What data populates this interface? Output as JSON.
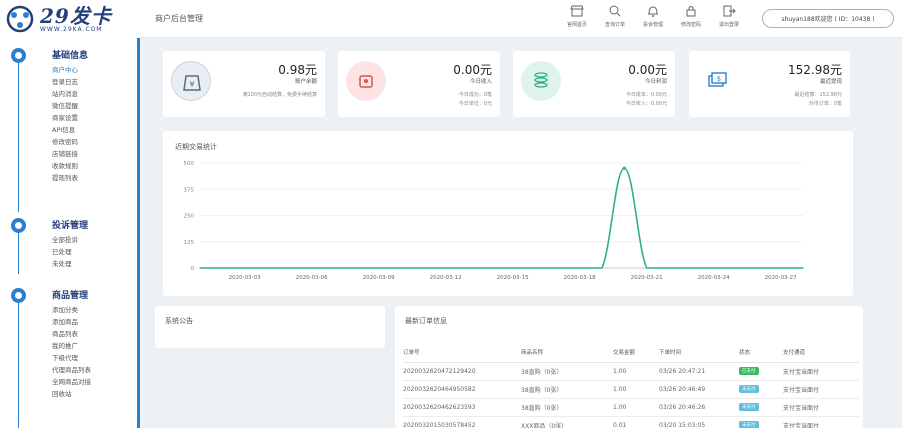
{
  "logo": {
    "main": "29发卡",
    "sub": "WWW.29KA.COM"
  },
  "header": {
    "title": "商户后台管理",
    "nav": [
      {
        "label": "官网首页",
        "icon": "store-icon"
      },
      {
        "label": "查询订单",
        "icon": "search-icon"
      },
      {
        "label": "投诉管理",
        "icon": "bell-icon"
      },
      {
        "label": "修改密码",
        "icon": "lock-icon"
      },
      {
        "label": "退出登录",
        "icon": "logout-icon"
      }
    ],
    "user": "shuyan188欢迎您 ( ID：10438 )"
  },
  "sidebar": {
    "groups": [
      {
        "title": "基础信息",
        "items": [
          "商户中心",
          "登录日志",
          "站内消息",
          "微信提醒",
          "商家设置",
          "API信息",
          "修改密码",
          "店铺链接",
          "收款规则",
          "提现列表"
        ]
      },
      {
        "title": "投诉管理",
        "items": [
          "全部投诉",
          "已处理",
          "未处理"
        ]
      },
      {
        "title": "商品管理",
        "items": [
          "添加分类",
          "添加商品",
          "商品列表",
          "我的推广",
          "下级代理",
          "代理商品列表",
          "全网商品对接",
          "回收站"
        ]
      }
    ]
  },
  "stats": [
    {
      "value": "0.98元",
      "label": "账户余额",
      "subs": [
        "满100元自动结算，免费手续结算"
      ],
      "color": "#e9eef4",
      "icon": "money-bag-icon"
    },
    {
      "value": "0.00元",
      "label": "今日收入",
      "subs": [
        "今日成功：0笔",
        "今日单位：0元"
      ],
      "color": "#fde3e3",
      "icon": "wallet-icon"
    },
    {
      "value": "0.00元",
      "label": "今日利润",
      "subs": [
        "今日成本：0.00元",
        "今日收入：0.00元"
      ],
      "color": "#dff3ec",
      "icon": "coins-icon"
    },
    {
      "value": "152.98元",
      "label": "最近提现",
      "subs": [
        "最近结算：152.98元",
        "外币订单：0笔"
      ],
      "color": "#ffffff",
      "icon": "cash-icon"
    }
  ],
  "chart_data": {
    "type": "line",
    "title": "近期交易统计",
    "x": [
      "2020-03-01",
      "2020-03-02",
      "2020-03-03",
      "2020-03-04",
      "2020-03-05",
      "2020-03-06",
      "2020-03-07",
      "2020-03-08",
      "2020-03-09",
      "2020-03-10",
      "2020-03-11",
      "2020-03-12",
      "2020-03-13",
      "2020-03-14",
      "2020-03-15",
      "2020-03-16",
      "2020-03-17",
      "2020-03-18",
      "2020-03-19",
      "2020-03-20",
      "2020-03-21",
      "2020-03-22",
      "2020-03-23",
      "2020-03-24",
      "2020-03-25",
      "2020-03-26",
      "2020-03-27",
      "2020-03-28"
    ],
    "x_tick_labels": [
      "2020-03-03",
      "2020-03-06",
      "2020-03-09",
      "2020-03-12",
      "2020-03-15",
      "2020-03-18",
      "2020-03-21",
      "2020-03-24",
      "2020-03-27"
    ],
    "y_ticks": [
      "500",
      "375",
      "250",
      "125",
      "0"
    ],
    "ylim": [
      0,
      500
    ],
    "values": [
      0,
      0,
      0,
      0,
      0,
      0,
      0,
      0,
      0,
      0,
      0,
      0,
      0,
      0,
      0,
      0,
      0,
      0,
      0,
      475,
      0,
      0,
      0,
      0,
      0,
      0,
      0,
      0
    ],
    "color": "#2fb380"
  },
  "notice": {
    "title": "系统公告"
  },
  "orders": {
    "title": "最新订单信息",
    "columns": [
      "订单号",
      "商品名称",
      "交易金额",
      "下单时间",
      "状态",
      "支付通道"
    ],
    "rows": [
      [
        "2020032620472129420",
        "38直购（0张）",
        "1.00",
        "03/26 20:47:21",
        "已支付",
        "支付宝当面付"
      ],
      [
        "2020032620464950582",
        "38直购（0张）",
        "1.00",
        "03/26 20:46:49",
        "未支付",
        "支付宝当面付"
      ],
      [
        "2020032620462623593",
        "38直购（0张）",
        "1.00",
        "03/26 20:46:26",
        "未支付",
        "支付宝当面付"
      ],
      [
        "2020032015030578452",
        "XXX商品（0张）",
        "0.01",
        "03/20 15:03:05",
        "未支付",
        "支付宝当面付"
      ]
    ],
    "status_colors": {
      "已支付": "#3cb95f",
      "未支付": "#5bc0de"
    }
  }
}
